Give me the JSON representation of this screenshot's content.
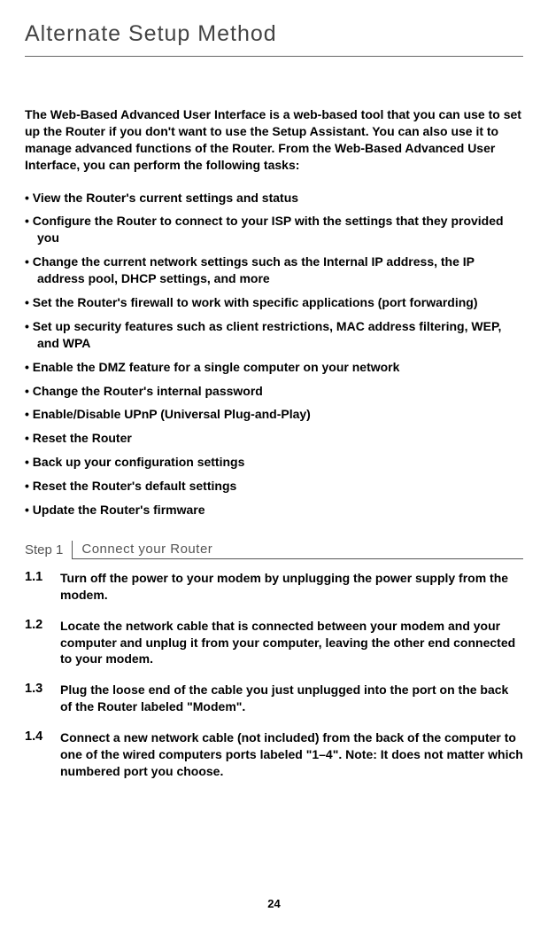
{
  "title": "Alternate Setup Method",
  "intro": "The Web-Based Advanced User Interface is a web-based tool that you can use to set up the Router if you don't want to use the Setup Assistant. You can also use it to manage advanced functions of the Router. From the Web-Based Advanced User Interface, you can perform the following tasks:",
  "bullets": [
    "View the Router's current settings and status",
    "Configure the Router to connect to your ISP with the settings that they provided you",
    "Change the current network settings such as the Internal IP address, the IP address pool, DHCP settings, and more",
    "Set the Router's firewall to work with specific applications (port forwarding)",
    "Set up security features such as client restrictions, MAC address filtering, WEP, and WPA",
    "Enable the DMZ feature for a single computer on your network",
    "Change the Router's internal password",
    "Enable/Disable UPnP (Universal Plug-and-Play)",
    "Reset the Router",
    "Back up your configuration settings",
    "Reset the Router's default settings",
    "Update the Router's firmware"
  ],
  "step": {
    "label": "Step 1",
    "title": "Connect your Router",
    "items": [
      {
        "num": "1.1",
        "text": "Turn off the power to your modem by unplugging the power supply from the modem."
      },
      {
        "num": "1.2",
        "text": "Locate the network cable that is connected between your modem and your computer and unplug it from your computer, leaving the other end connected to your modem."
      },
      {
        "num": "1.3",
        "text": "Plug the loose end of the cable you just unplugged into the port on the back of the Router labeled \"Modem\"."
      },
      {
        "num": "1.4",
        "text": "Connect a new network cable (not included) from the back of the computer to one of the wired computers ports labeled \"1–4\". Note: It does not matter which numbered port you choose."
      }
    ]
  },
  "pageNumber": "24"
}
